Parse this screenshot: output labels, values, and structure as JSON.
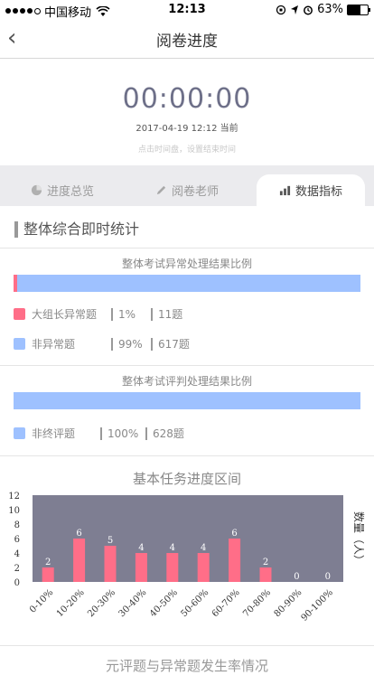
{
  "status": {
    "carrier": "中国移动",
    "time": "12:13",
    "battery": "63%",
    "battery_level": 0.63
  },
  "nav": {
    "back_icon": "chevron-left-icon",
    "title": "阅卷进度"
  },
  "timer": {
    "value": "00:00:00",
    "sub": "2017-04-19 12:12 当前",
    "hint": "点击时间盘，设置结束时间"
  },
  "tabs": [
    {
      "label": "进度总览",
      "icon": "pie-icon"
    },
    {
      "label": "阅卷老师",
      "icon": "pencil-icon"
    },
    {
      "label": "数据指标",
      "icon": "bar-chart-icon"
    }
  ],
  "section_title": "整体综合即时统计",
  "abnormal": {
    "title": "整体考试异常处理结果比例",
    "fraction_abnormal": 0.01,
    "colors": {
      "abnormal": "#ff6e88",
      "normal": "#9ec1ff"
    },
    "rows": [
      {
        "label": "大组长异常题",
        "percent": "1%",
        "count": "11题"
      },
      {
        "label": "非异常题",
        "percent": "99%",
        "count": "617题"
      }
    ]
  },
  "judge": {
    "title": "整体考试评判处理结果比例",
    "rows": [
      {
        "label": "非终评题",
        "percent": "100%",
        "count": "628题"
      }
    ]
  },
  "chart_data": {
    "type": "bar",
    "title": "基本任务进度区间",
    "ylabel": "数量（人）",
    "xlabel": "",
    "categories": [
      "0-10%",
      "10-20%",
      "20-30%",
      "30-40%",
      "40-50%",
      "50-60%",
      "60-70%",
      "70-80%",
      "80-90%",
      "90-100%"
    ],
    "values": [
      2,
      6,
      5,
      4,
      4,
      4,
      6,
      2,
      0,
      0
    ],
    "ylim": [
      0,
      12
    ],
    "yticks": [
      0,
      2,
      4,
      6,
      8,
      10,
      12
    ],
    "colors": {
      "bar": "#ff6e88",
      "plot_bg": "#7e7e92"
    }
  },
  "next_section": "元评题与异常题发生率情况"
}
